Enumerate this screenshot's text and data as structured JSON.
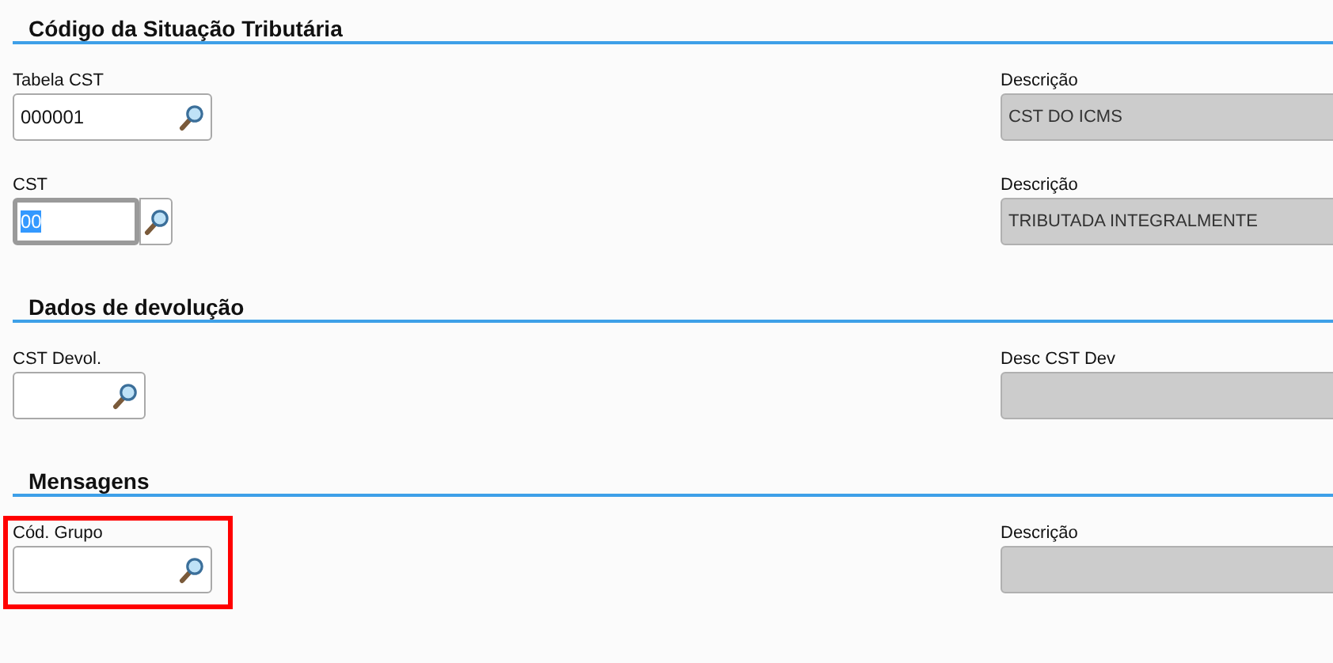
{
  "sections": [
    {
      "title": "Código da Situação Tributária",
      "rows": [
        {
          "highlighted": false,
          "field": {
            "label": "Tabela CST",
            "kind": "lookup",
            "value": "000001",
            "focused": false
          },
          "description": {
            "label": "Descrição",
            "value": "CST DO ICMS"
          }
        },
        {
          "highlighted": false,
          "field": {
            "label": "CST",
            "kind": "split",
            "value": "00",
            "focused": true,
            "value_selected": true
          },
          "description": {
            "label": "Descrição",
            "value": "TRIBUTADA INTEGRALMENTE"
          }
        }
      ]
    },
    {
      "title": "Dados de devolução",
      "rows": [
        {
          "highlighted": false,
          "field": {
            "label": "CST Devol.",
            "kind": "compact",
            "focused": false
          },
          "description": {
            "label": "Desc CST Dev"
          }
        }
      ]
    },
    {
      "title": "Mensagens",
      "rows": [
        {
          "highlighted": true,
          "field": {
            "label": "Cód. Grupo",
            "kind": "lookup",
            "focused": false
          },
          "description": {
            "label": "Descrição"
          }
        }
      ]
    }
  ]
}
